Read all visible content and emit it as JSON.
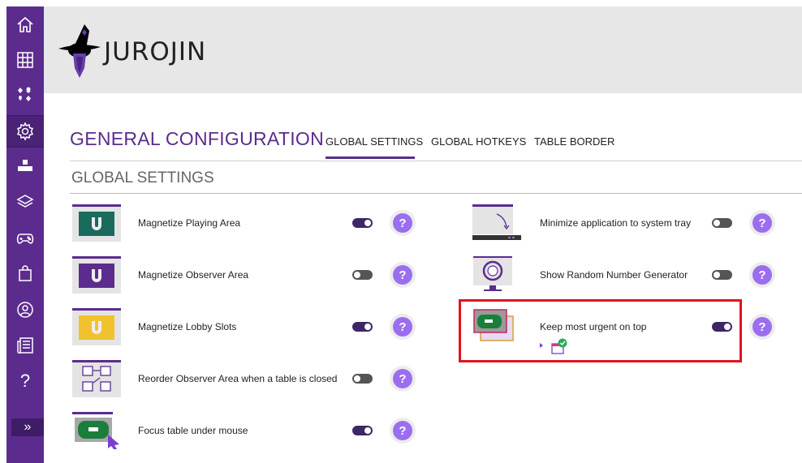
{
  "app": {
    "logo_text": "JUROJIN"
  },
  "sidebar": {
    "items": [
      {
        "name": "home-icon"
      },
      {
        "name": "grid-icon"
      },
      {
        "name": "card-suits-icon"
      },
      {
        "name": "gear-icon"
      },
      {
        "name": "keyboard-icon"
      },
      {
        "name": "layers-icon"
      },
      {
        "name": "gamepad-icon"
      },
      {
        "name": "bag-icon"
      },
      {
        "name": "user-icon"
      },
      {
        "name": "news-icon"
      },
      {
        "name": "question-icon",
        "label": "?"
      }
    ],
    "expand_label": "»"
  },
  "page": {
    "title": "GENERAL CONFIGURATION",
    "tabs": [
      {
        "label": "GLOBAL SETTINGS",
        "active": true
      },
      {
        "label": "GLOBAL HOTKEYS",
        "active": false
      },
      {
        "label": "TABLE BORDER",
        "active": false
      }
    ],
    "section_title": "GLOBAL SETTINGS"
  },
  "settings": {
    "left": [
      {
        "label": "Magnetize Playing Area",
        "on": true
      },
      {
        "label": "Magnetize Observer Area",
        "on": false
      },
      {
        "label": "Magnetize Lobby Slots",
        "on": true
      },
      {
        "label": "Reorder Observer Area when a table is closed",
        "on": false
      },
      {
        "label": "Focus table under mouse",
        "on": true
      }
    ],
    "right": [
      {
        "label": "Minimize application to system tray",
        "on": false
      },
      {
        "label": "Show Random Number Generator",
        "on": false
      },
      {
        "label": "Keep most urgent on top",
        "on": true
      }
    ]
  },
  "help_label": "?",
  "colors": {
    "accent": "#5b2c8e",
    "help": "#9b6ef0",
    "highlight": "#e0141e"
  }
}
